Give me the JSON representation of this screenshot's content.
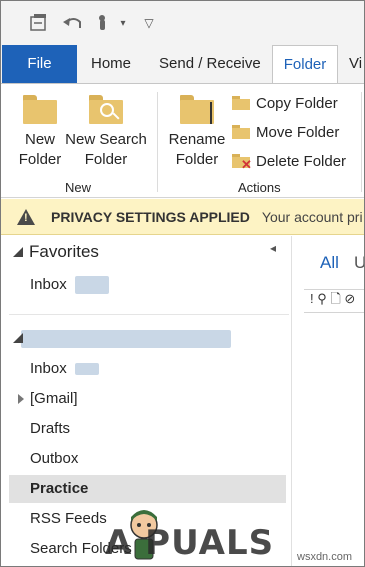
{
  "ribbon_tabs": {
    "file": "File",
    "home": "Home",
    "send_receive": "Send / Receive",
    "folder": "Folder",
    "view": "Vi"
  },
  "ribbon": {
    "new_folder": [
      "New",
      "Folder"
    ],
    "new_search_folder": [
      "New Search",
      "Folder"
    ],
    "rename_folder": [
      "Rename",
      "Folder"
    ],
    "copy_folder": "Copy Folder",
    "move_folder": "Move Folder",
    "delete_folder": "Delete Folder",
    "group_new": "New",
    "group_actions": "Actions"
  },
  "privacy_bar": {
    "title": "PRIVACY SETTINGS APPLIED",
    "message": "Your account pri"
  },
  "folder_pane": {
    "favorites_label": "Favorites",
    "favorites_inbox": "Inbox",
    "account_items": [
      "Inbox",
      "[Gmail]",
      "Drafts",
      "Outbox",
      "Practice",
      "RSS Feeds",
      "Search Folders"
    ],
    "selected": "Practice"
  },
  "message_list": {
    "all": "All",
    "unread": "U",
    "header_icons": "! ⚲ 🗋 ⊘"
  },
  "watermark": {
    "brand": "A  PUALS",
    "site": "wsxdn.com"
  },
  "colors": {
    "file_tab": "#1e62b8",
    "accent": "#1e62b8",
    "privacy_bg": "#fdf3c4",
    "selection": "#e1e1e1"
  }
}
